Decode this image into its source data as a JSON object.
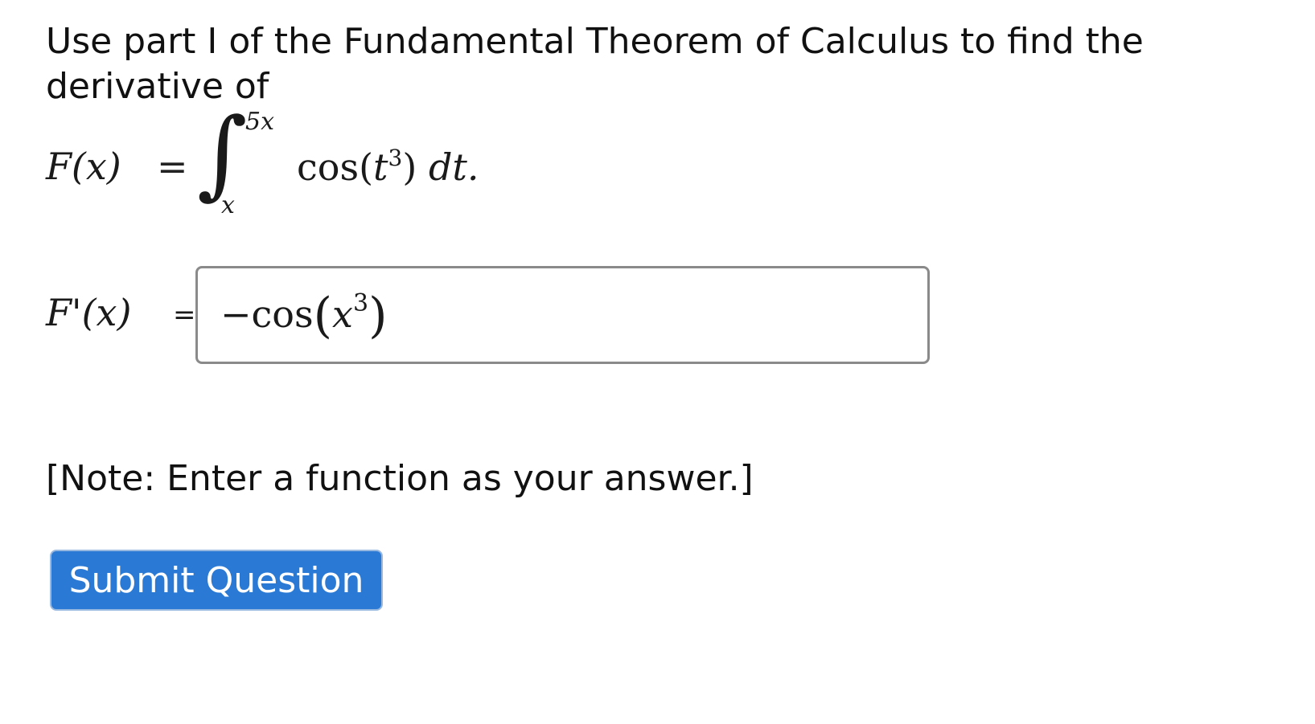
{
  "question": {
    "prompt": "Use part I of the Fundamental Theorem of Calculus to find the derivative of",
    "formula": {
      "lhs": "F(x)",
      "equals": "=",
      "integral_sign": "∫",
      "upper_limit": "5x",
      "lower_limit": "x",
      "integrand_func": "cos",
      "integrand_var": "t",
      "integrand_exp": "3",
      "differential": "dt."
    },
    "answer_label": "F'(x)",
    "answer_equals": "=",
    "answer_value": {
      "sign": "−",
      "func": "cos",
      "var": "x",
      "exp": "3"
    },
    "note": "[Note: Enter a function as your answer.]"
  },
  "submit_button": {
    "label": "Submit Question"
  },
  "colors": {
    "button_bg": "#2a7ad5",
    "input_border": "#8a8a8a"
  }
}
